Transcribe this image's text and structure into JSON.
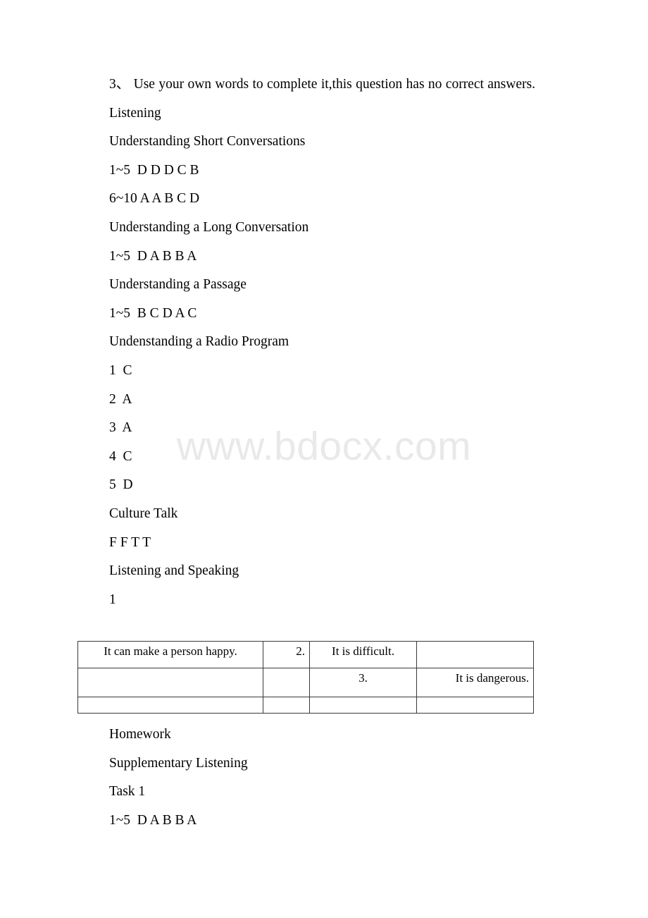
{
  "document": {
    "watermark": "www.bdocx.com",
    "body": [
      {
        "id": "intro",
        "style": "lead",
        "text": "3、 Use your own words to complete it,this question has no correct answers."
      },
      {
        "id": "listening",
        "style": "indent",
        "text": "Listening"
      },
      {
        "id": "short-conversations-heading",
        "style": "indent",
        "text": "Understanding Short Conversations"
      },
      {
        "id": "short-conversations-answers-1-5",
        "style": "indent",
        "text": "1~5  D D D C B"
      },
      {
        "id": "short-conversations-answers-6-10",
        "style": "indent",
        "text": "6~10 A A B C D"
      },
      {
        "id": "long-conversation-heading",
        "style": "indent",
        "text": "Understanding a Long Conversation"
      },
      {
        "id": "long-conversation-answers",
        "style": "indent",
        "text": "1~5  D A B B A"
      },
      {
        "id": "passage-heading",
        "style": "indent",
        "text": "Understanding a Passage"
      },
      {
        "id": "passage-answers",
        "style": "indent",
        "text": "1~5  B C D A C"
      },
      {
        "id": "radio-program-heading",
        "style": "indent",
        "text": "Undenstanding a Radio Program"
      },
      {
        "id": "radio-answer-1",
        "style": "indent",
        "text": "1  C"
      },
      {
        "id": "radio-answer-2",
        "style": "indent",
        "text": "2  A"
      },
      {
        "id": "radio-answer-3",
        "style": "indent",
        "text": "3  A"
      },
      {
        "id": "radio-answer-4",
        "style": "indent",
        "text": "4  C"
      },
      {
        "id": "radio-answer-5",
        "style": "indent",
        "text": "5  D"
      },
      {
        "id": "culture-talk-heading",
        "style": "indent",
        "text": "Culture Talk"
      },
      {
        "id": "culture-talk-answers",
        "style": "indent",
        "text": "F F T T"
      },
      {
        "id": "listening-speaking-heading",
        "style": "indent",
        "text": "Listening and Speaking"
      },
      {
        "id": "listening-speaking-item-1",
        "style": "indent",
        "text": "1"
      }
    ],
    "table": {
      "rows": [
        [
          {
            "text": "It can make a person happy.",
            "align": "center"
          },
          {
            "text": "2.",
            "align": "right"
          },
          {
            "text": "It is difficult.",
            "align": "center"
          },
          {
            "text": "",
            "align": "left"
          }
        ],
        [
          {
            "text": "",
            "align": "left"
          },
          {
            "text": "",
            "align": "left"
          },
          {
            "text": "3.",
            "align": "center"
          },
          {
            "text": "It is dangerous.",
            "align": "right"
          }
        ],
        [
          {
            "text": "",
            "align": "left"
          },
          {
            "text": "",
            "align": "left"
          },
          {
            "text": "",
            "align": "left"
          },
          {
            "text": "",
            "align": "left"
          }
        ]
      ]
    },
    "body_after_table": [
      {
        "id": "homework-heading",
        "style": "indent",
        "text": "Homework"
      },
      {
        "id": "supplementary-listening-heading",
        "style": "indent",
        "text": "Supplementary Listening"
      },
      {
        "id": "task-1-heading",
        "style": "indent",
        "text": "Task 1"
      },
      {
        "id": "task-1-answers",
        "style": "indent",
        "text": "1~5  D A B B A"
      }
    ]
  }
}
